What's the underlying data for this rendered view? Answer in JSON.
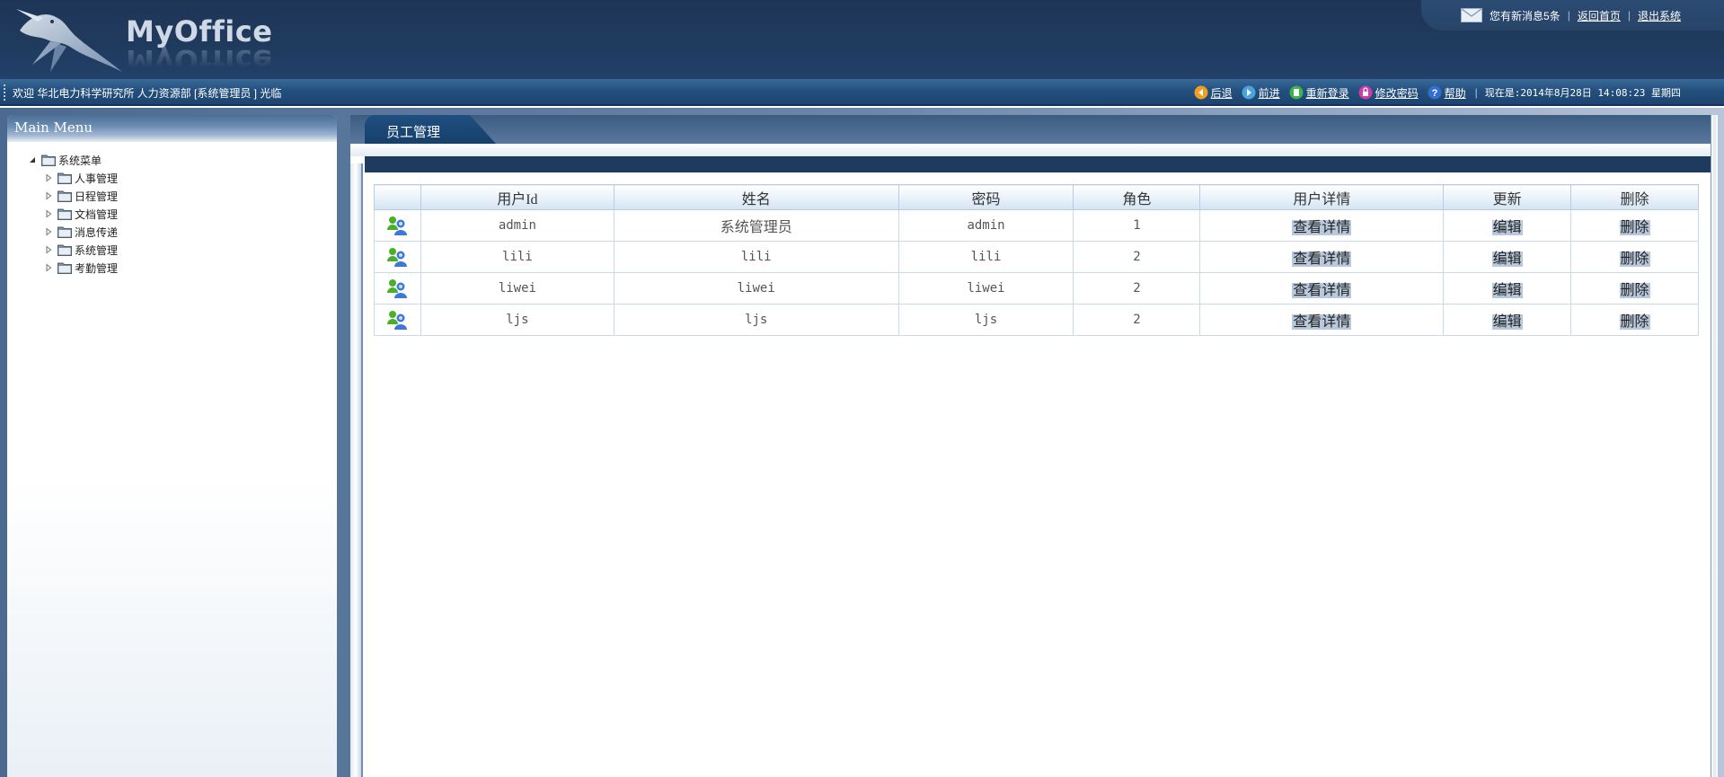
{
  "app": {
    "brand": "MyOffice",
    "top_links": {
      "message": "您有新消息5条",
      "home": "返回首页",
      "logout": "退出系统"
    }
  },
  "info_bar": {
    "welcome": "欢迎 华北电力科学研究所 人力资源部 [系统管理员 ] 光临",
    "toolbar": [
      {
        "label": "后退",
        "icon": "back-icon"
      },
      {
        "label": "前进",
        "icon": "forward-icon"
      },
      {
        "label": "重新登录",
        "icon": "relogin-icon"
      },
      {
        "label": "修改密码",
        "icon": "password-icon"
      },
      {
        "label": "帮助",
        "icon": "help-icon"
      }
    ],
    "clock": "现在是:2014年8月28日 14:08:23 星期四"
  },
  "sidebar": {
    "title": "Main Menu",
    "root": "系统菜单",
    "items": [
      {
        "label": "人事管理"
      },
      {
        "label": "日程管理"
      },
      {
        "label": "文档管理"
      },
      {
        "label": "消息传递"
      },
      {
        "label": "系统管理"
      },
      {
        "label": "考勤管理"
      }
    ]
  },
  "main": {
    "tab": "员工管理",
    "table": {
      "columns": [
        "",
        "用户Id",
        "姓名",
        "密码",
        "角色",
        "用户详情",
        "更新",
        "删除"
      ],
      "rows": [
        {
          "id": "admin",
          "name": "系统管理员",
          "password": "admin",
          "role": "1",
          "details": "查看详情",
          "edit": "编辑",
          "delete": "删除"
        },
        {
          "id": "lili",
          "name": "lili",
          "password": "lili",
          "role": "2",
          "details": "查看详情",
          "edit": "编辑",
          "delete": "删除"
        },
        {
          "id": "liwei",
          "name": "liwei",
          "password": "liwei",
          "role": "2",
          "details": "查看详情",
          "edit": "编辑",
          "delete": "删除"
        },
        {
          "id": "ljs",
          "name": "ljs",
          "password": "ljs",
          "role": "2",
          "details": "查看详情",
          "edit": "编辑",
          "delete": "删除"
        }
      ]
    }
  },
  "colors": {
    "banner": "#203a5d",
    "info_bar": "#24507e",
    "table_border": "#c7d9ea",
    "action_highlight": "#b9c9dd"
  }
}
